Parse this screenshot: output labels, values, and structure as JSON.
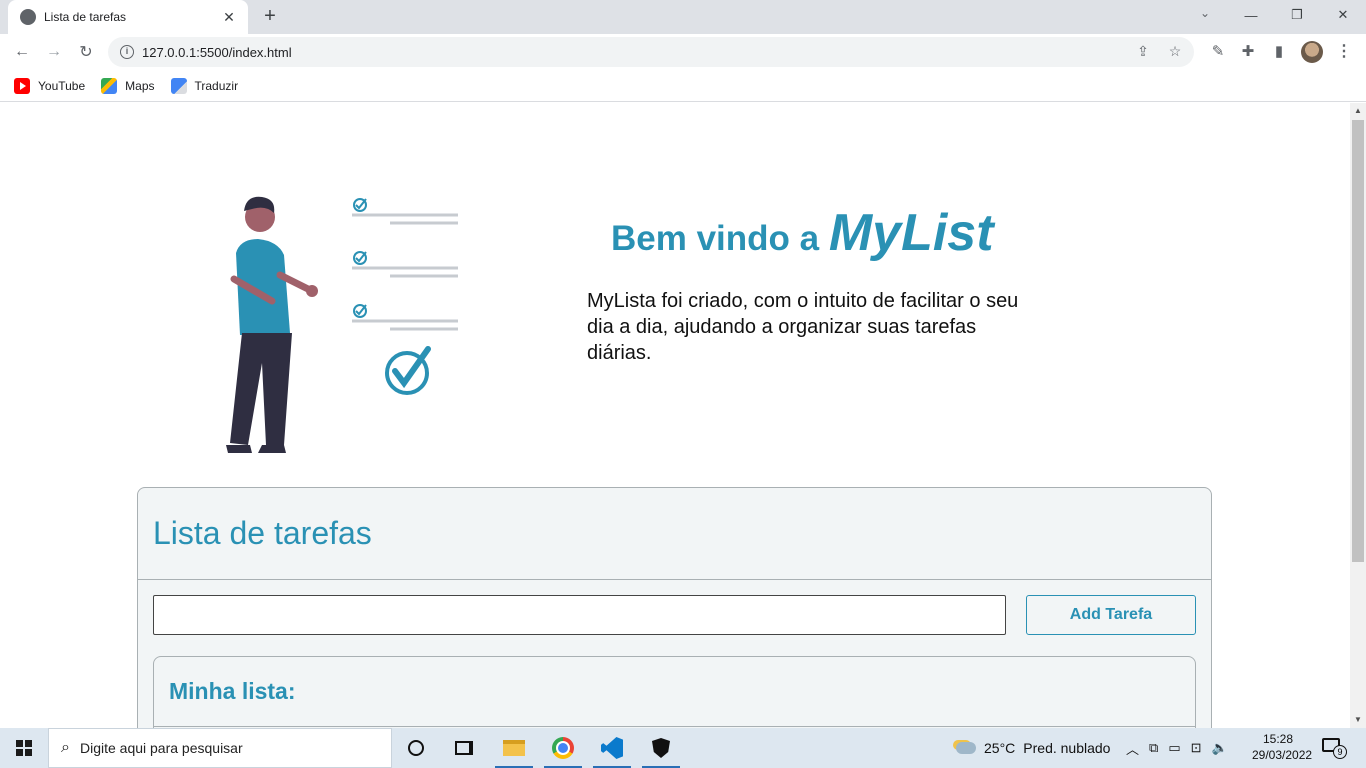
{
  "browser": {
    "tab_title": "Lista de tarefas",
    "new_tab": "+",
    "url": "127.0.0.1:5500/index.html",
    "bookmarks": [
      {
        "label": "YouTube",
        "icon": "youtube-icon"
      },
      {
        "label": "Maps",
        "icon": "maps-icon"
      },
      {
        "label": "Traduzir",
        "icon": "translate-icon"
      }
    ]
  },
  "hero": {
    "welcome_prefix": "Bem vindo a ",
    "brand": "MyList",
    "description": "MyLista foi criado, com o intuito de facilitar o seu dia a dia, ajudando a organizar suas tarefas diárias."
  },
  "todo": {
    "title": "Lista de tarefas",
    "input_value": "",
    "input_placeholder": "",
    "add_button": "Add Tarefa",
    "list_title": "Minha lista:"
  },
  "taskbar": {
    "search_placeholder": "Digite aqui para pesquisar",
    "temperature": "25°C",
    "weather": "Pred. nublado",
    "time": "15:28",
    "date": "29/03/2022",
    "notifications": "9"
  },
  "colors": {
    "accent": "#2a91b4",
    "card_bg": "#f2f5f6"
  }
}
